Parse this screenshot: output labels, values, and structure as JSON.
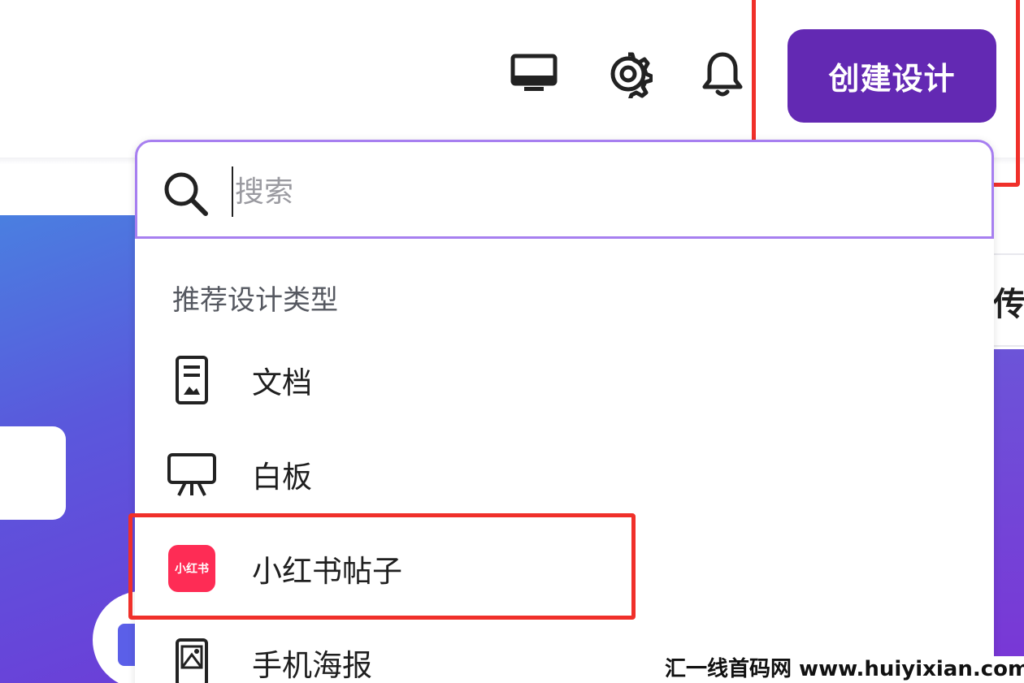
{
  "header": {
    "create_button_label": "创建设计",
    "icons": [
      "desktop-icon",
      "gear-icon",
      "bell-icon"
    ]
  },
  "background": {
    "right_clip_text": "传"
  },
  "dropdown": {
    "search": {
      "placeholder": "搜索",
      "value": ""
    },
    "section_title": "推荐设计类型",
    "items": [
      {
        "label": "文档",
        "icon": "document-icon"
      },
      {
        "label": "白板",
        "icon": "whiteboard-icon"
      },
      {
        "label": "小红书帖子",
        "icon": "xiaohongshu-icon",
        "icon_text": "小红书"
      },
      {
        "label": "手机海报",
        "icon": "phone-poster-icon"
      }
    ]
  },
  "watermark": "汇一线首码网 www.huiyixian.com",
  "colors": {
    "accent": "#6329b3",
    "search_border": "#a77ff0",
    "highlight": "#f0302a",
    "xiaohongshu": "#fe2c55"
  }
}
